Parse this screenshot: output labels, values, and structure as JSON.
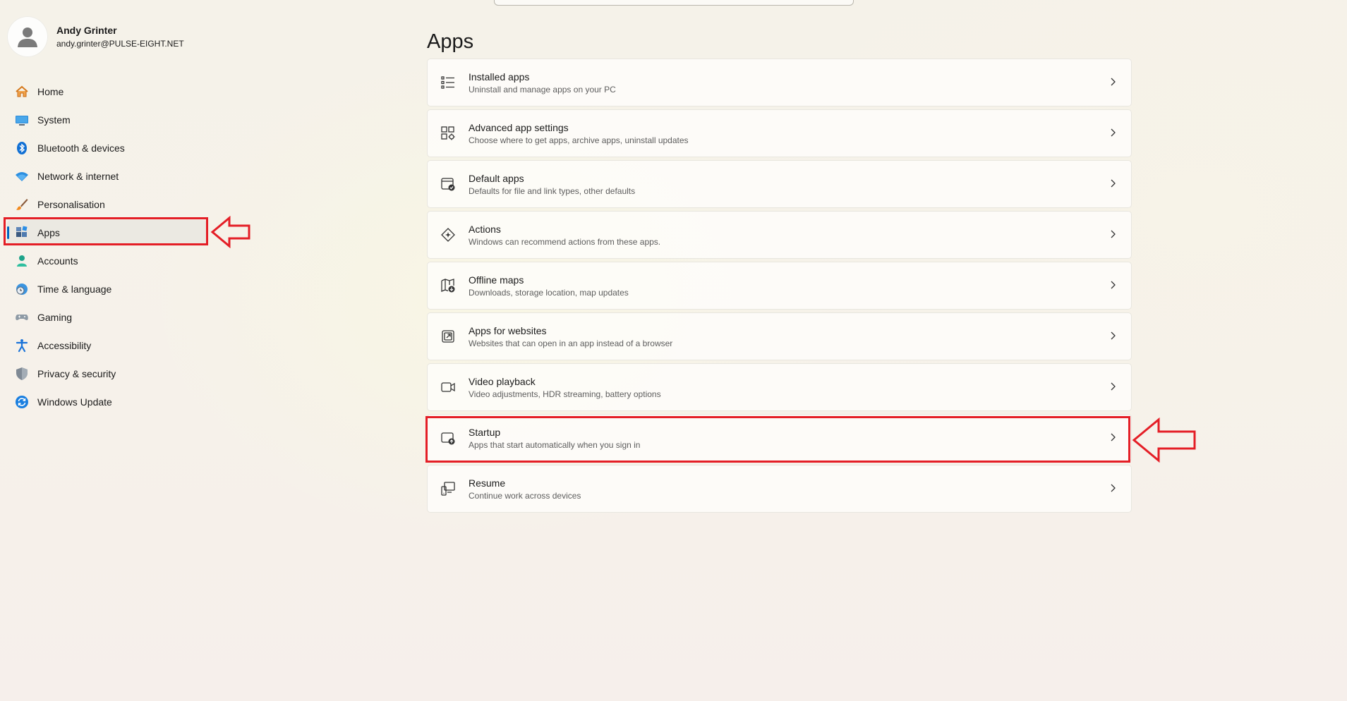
{
  "profile": {
    "name": "Andy Grinter",
    "email": "andy.grinter@PULSE-EIGHT.NET",
    "avatar_icon": "user-icon"
  },
  "nav": {
    "items": [
      {
        "label": "Home",
        "icon": "home-icon"
      },
      {
        "label": "System",
        "icon": "display-icon"
      },
      {
        "label": "Bluetooth & devices",
        "icon": "bluetooth-icon"
      },
      {
        "label": "Network & internet",
        "icon": "wifi-icon"
      },
      {
        "label": "Personalisation",
        "icon": "brush-icon"
      },
      {
        "label": "Apps",
        "icon": "apps-icon",
        "selected": true
      },
      {
        "label": "Accounts",
        "icon": "person-icon"
      },
      {
        "label": "Time & language",
        "icon": "clock-globe-icon"
      },
      {
        "label": "Gaming",
        "icon": "gamepad-icon"
      },
      {
        "label": "Accessibility",
        "icon": "accessibility-icon"
      },
      {
        "label": "Privacy & security",
        "icon": "shield-icon"
      },
      {
        "label": "Windows Update",
        "icon": "update-icon"
      }
    ]
  },
  "page": {
    "title": "Apps",
    "cards": [
      {
        "title": "Installed apps",
        "subtitle": "Uninstall and manage apps on your PC",
        "icon": "list-icon"
      },
      {
        "title": "Advanced app settings",
        "subtitle": "Choose where to get apps, archive apps, uninstall updates",
        "icon": "app-settings-icon"
      },
      {
        "title": "Default apps",
        "subtitle": "Defaults for file and link types, other defaults",
        "icon": "default-apps-icon"
      },
      {
        "title": "Actions",
        "subtitle": "Windows can recommend actions from these apps.",
        "icon": "actions-icon"
      },
      {
        "title": "Offline maps",
        "subtitle": "Downloads, storage location, map updates",
        "icon": "map-icon"
      },
      {
        "title": "Apps for websites",
        "subtitle": "Websites that can open in an app instead of a browser",
        "icon": "open-in-app-icon"
      },
      {
        "title": "Video playback",
        "subtitle": "Video adjustments, HDR streaming, battery options",
        "icon": "video-icon"
      },
      {
        "title": "Startup",
        "subtitle": "Apps that start automatically when you sign in",
        "icon": "startup-icon"
      },
      {
        "title": "Resume",
        "subtitle": "Continue work across devices",
        "icon": "resume-icon"
      }
    ]
  },
  "annotations": {
    "color": "#e41e26",
    "highlighted": [
      "Apps",
      "Startup"
    ]
  },
  "colors": {
    "accent": "#0067c0"
  }
}
